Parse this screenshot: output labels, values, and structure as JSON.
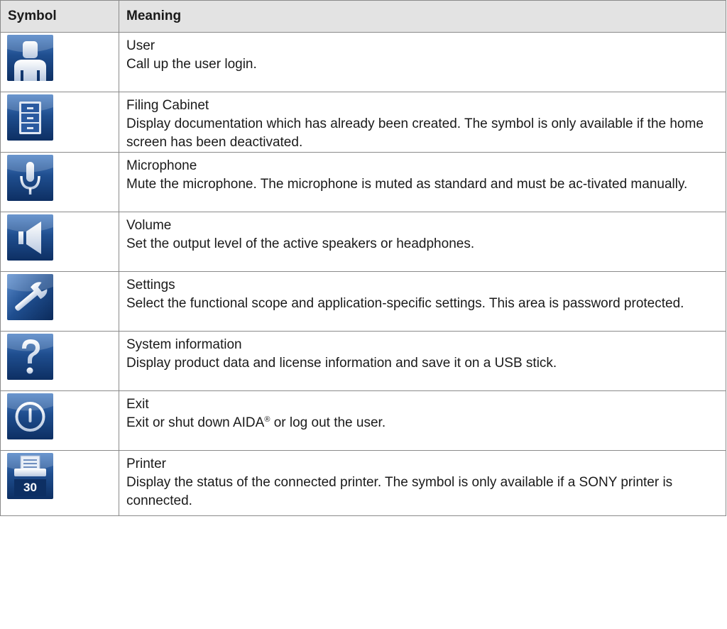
{
  "header": {
    "symbol": "Symbol",
    "meaning": "Meaning"
  },
  "rows": [
    {
      "icon": "user-icon",
      "title": "User",
      "description": "Call up the user login."
    },
    {
      "icon": "filing-cabinet-icon",
      "title": "Filing Cabinet",
      "description": "Display documentation which has already been created. The symbol is only available if the home screen has been deactivated."
    },
    {
      "icon": "microphone-icon",
      "title": "Microphone",
      "description": "Mute the microphone. The microphone is muted as standard and must be ac-tivated manually."
    },
    {
      "icon": "volume-icon",
      "title": "Volume",
      "description": "Set the output level of the active speakers or headphones."
    },
    {
      "icon": "wrench-icon",
      "title": "Settings",
      "description": "Select the functional scope and application-specific settings. This area is password protected."
    },
    {
      "icon": "question-mark-icon",
      "title": "System information",
      "description": "Display product data and license information and save it on a USB stick."
    },
    {
      "icon": "power-icon",
      "title": "Exit",
      "description_before": "Exit or shut down AIDA",
      "description_sup": "®",
      "description_after": " or log out the user."
    },
    {
      "icon": "printer-icon",
      "icon_badge": "30",
      "title": "Printer",
      "description": "Display the status of the connected printer. The symbol is only available if a SONY printer is connected."
    }
  ],
  "colors": {
    "icon_dark": "#0d2f63",
    "icon_light": "#3b6db0",
    "header_bg": "#e3e3e3",
    "border": "#8a8a8a"
  }
}
